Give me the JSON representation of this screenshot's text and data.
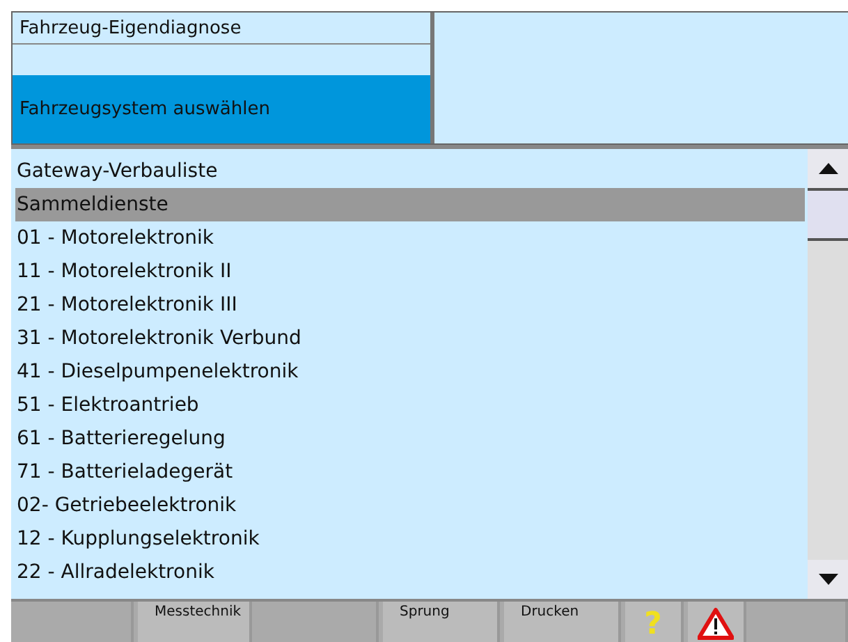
{
  "header": {
    "rows": [
      {
        "label": "Fahrzeug-Eigendiagnose",
        "selected": false
      },
      {
        "label": "",
        "selected": false
      },
      {
        "label": "Fahrzeugsystem auswählen",
        "selected": true
      }
    ]
  },
  "list": {
    "items": [
      {
        "label": "Gateway-Verbauliste",
        "selected": false
      },
      {
        "label": "Sammeldienste",
        "selected": true
      },
      {
        "label": "01 - Motorelektronik",
        "selected": false
      },
      {
        "label": "11 - Motorelektronik II",
        "selected": false
      },
      {
        "label": "21 - Motorelektronik III",
        "selected": false
      },
      {
        "label": "31 - Motorelektronik Verbund",
        "selected": false
      },
      {
        "label": "41 - Dieselpumpenelektronik",
        "selected": false
      },
      {
        "label": "51 - Elektroantrieb",
        "selected": false
      },
      {
        "label": "61 - Batterieregelung",
        "selected": false
      },
      {
        "label": "71 - Batterieladegerät",
        "selected": false
      },
      {
        "label": "02- Getriebeelektronik",
        "selected": false
      },
      {
        "label": "12 - Kupplungselektronik",
        "selected": false
      },
      {
        "label": "22 - Allradelektronik",
        "selected": false
      }
    ]
  },
  "toolbar": [
    {
      "kind": "blank"
    },
    {
      "kind": "text",
      "label": "Messtechnik"
    },
    {
      "kind": "blank"
    },
    {
      "kind": "text",
      "label": "Sprung"
    },
    {
      "kind": "text",
      "label": "Drucken"
    },
    {
      "kind": "help",
      "label": "?"
    },
    {
      "kind": "warning"
    },
    {
      "kind": "blank"
    }
  ]
}
